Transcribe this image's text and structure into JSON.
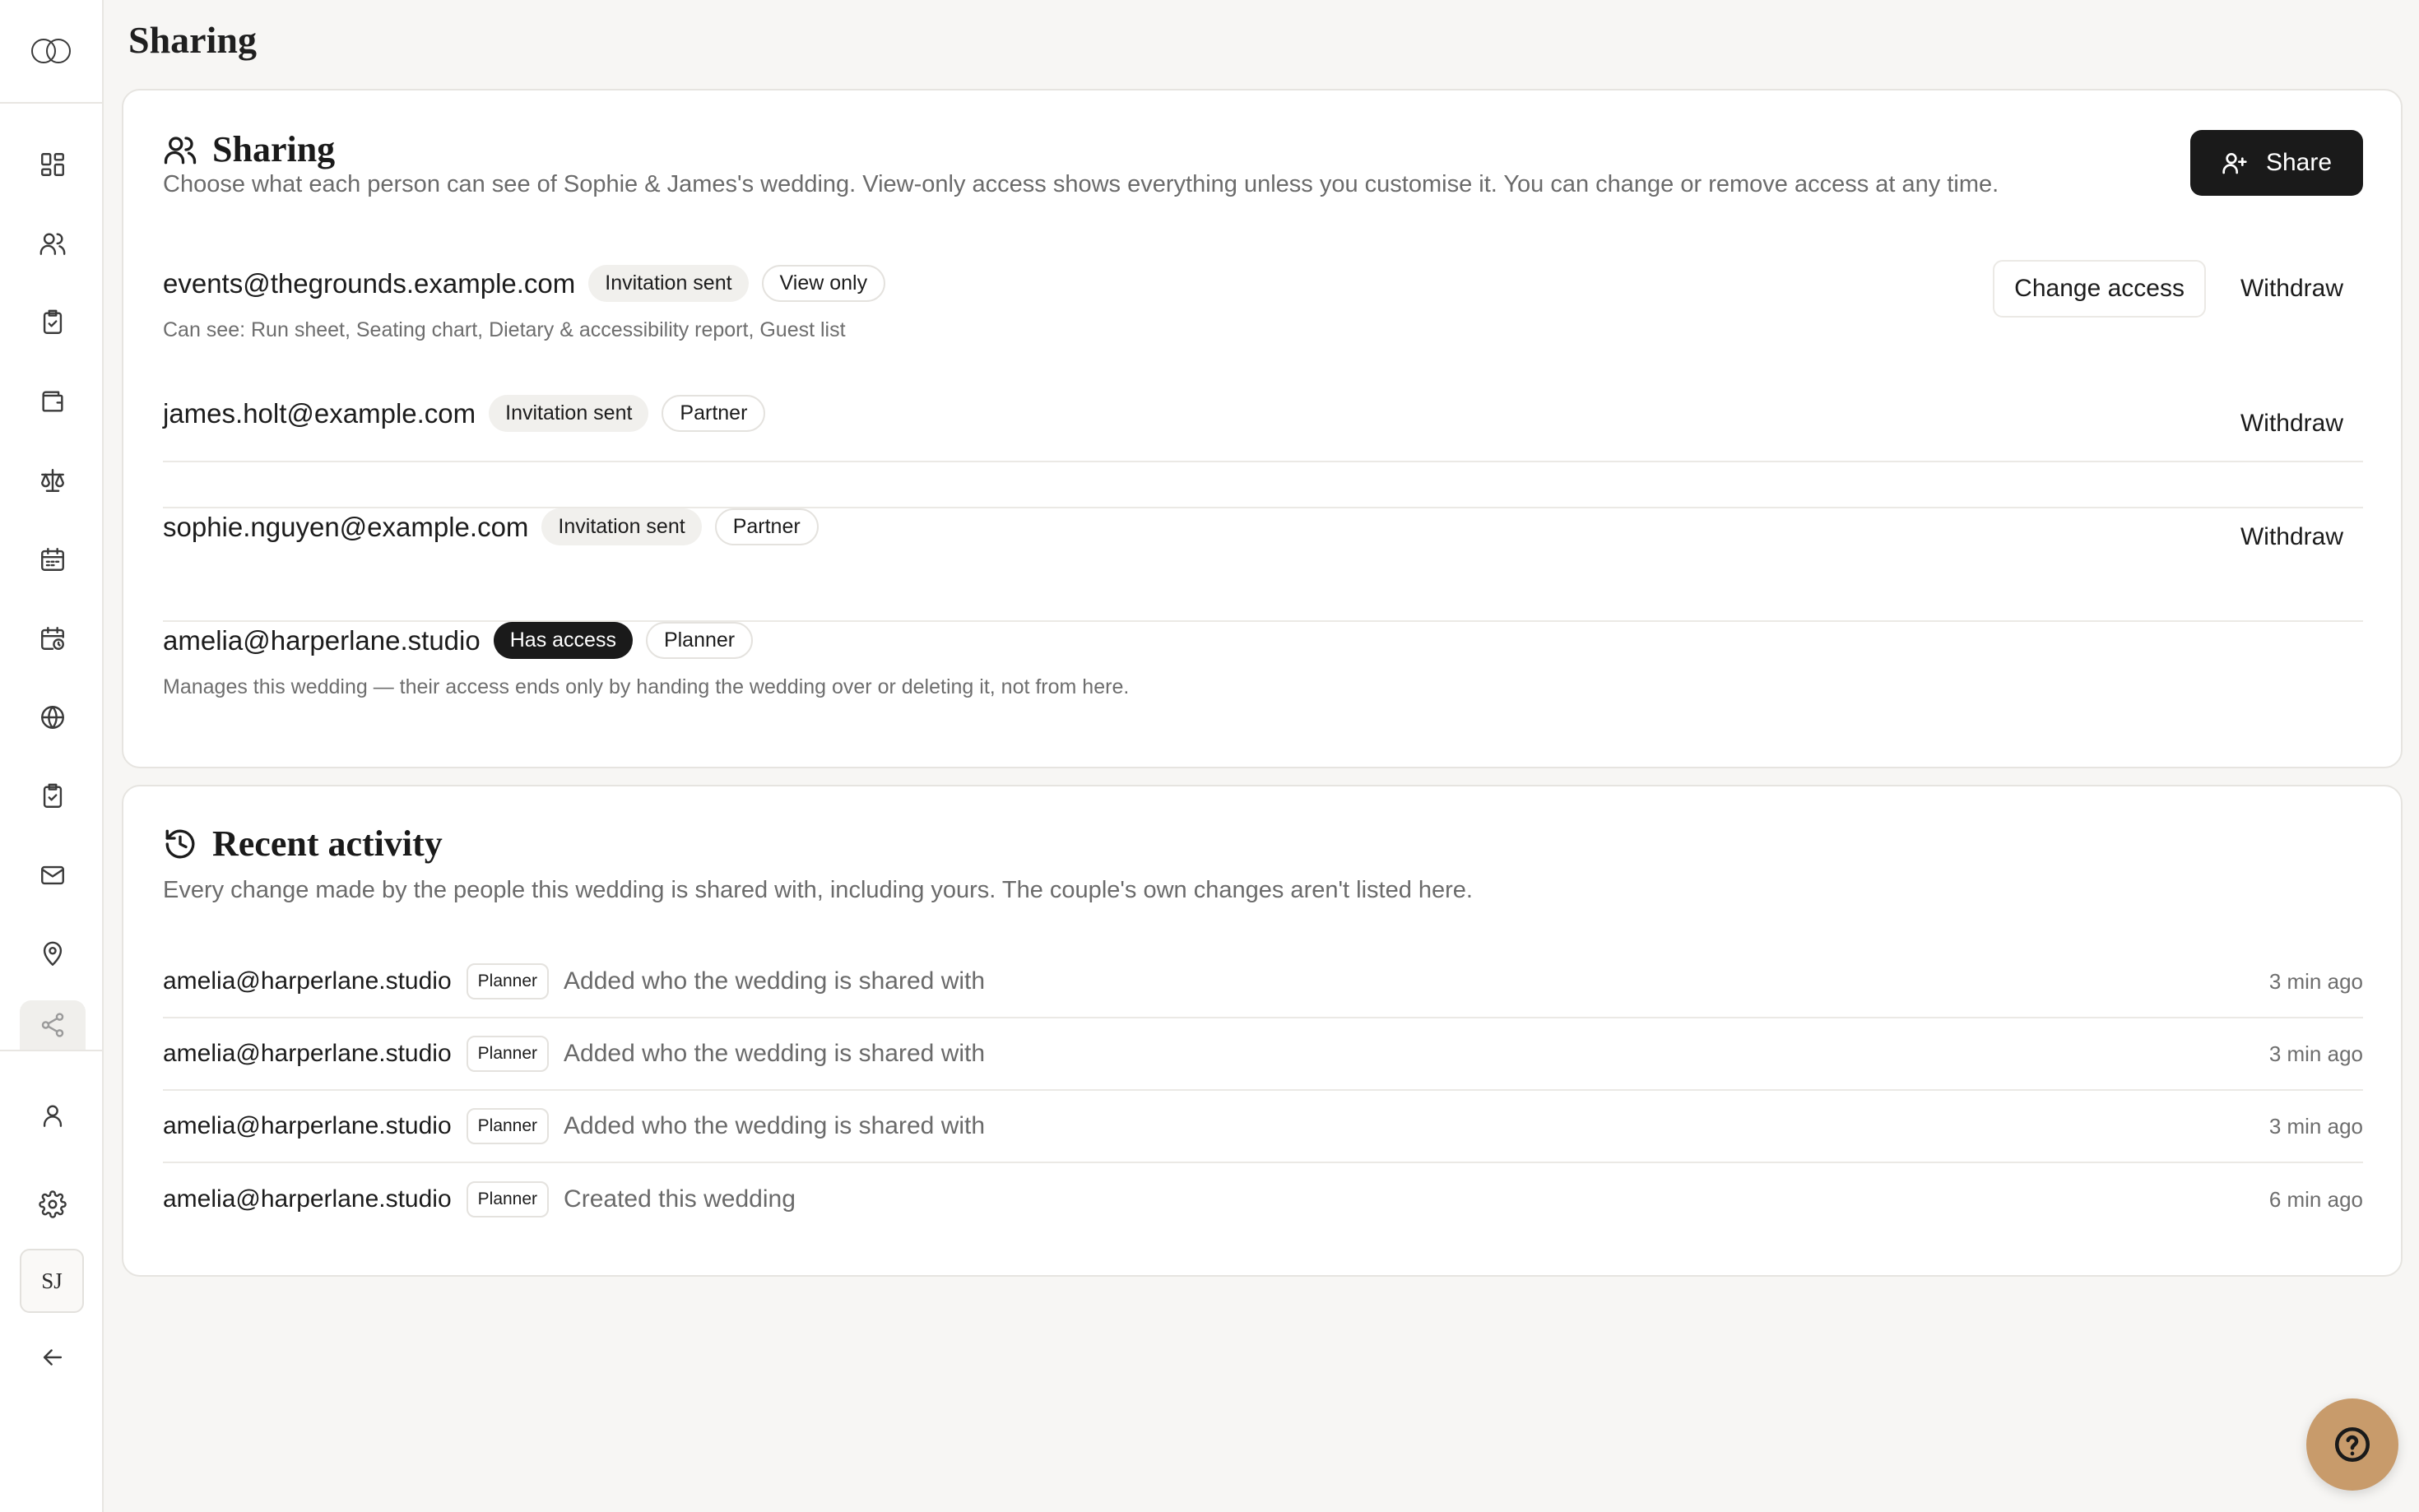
{
  "page": {
    "title": "Sharing"
  },
  "sidebar": {
    "items": [
      {
        "name": "dashboard-icon"
      },
      {
        "name": "guests-icon"
      },
      {
        "name": "checklist-icon"
      },
      {
        "name": "budget-icon"
      },
      {
        "name": "scales-icon"
      },
      {
        "name": "calendar-icon"
      },
      {
        "name": "schedule-icon"
      },
      {
        "name": "globe-icon"
      },
      {
        "name": "tasks-icon"
      },
      {
        "name": "mail-icon"
      },
      {
        "name": "location-icon"
      },
      {
        "name": "share-icon",
        "active": true
      }
    ],
    "bottom": [
      {
        "name": "user-icon"
      },
      {
        "name": "gear-icon"
      }
    ],
    "avatar_initials": "SJ",
    "back_icon": "arrow-left-icon"
  },
  "sharing": {
    "title": "Sharing",
    "description": "Choose what each person can see of Sophie & James's wedding. View-only access shows everything unless you customise it. You can change or remove access at any time.",
    "share_button": "Share",
    "people": [
      {
        "email": "events@thegrounds.example.com",
        "status": "Invitation sent",
        "role": "View only",
        "detail": "Can see: Run sheet, Seating chart, Dietary & accessibility report, Guest list",
        "change_label": "Change access",
        "withdraw_label": "Withdraw"
      },
      {
        "email": "james.holt@example.com",
        "status": "Invitation sent",
        "role": "Partner",
        "withdraw_label": "Withdraw"
      },
      {
        "email": "sophie.nguyen@example.com",
        "status": "Invitation sent",
        "role": "Partner",
        "withdraw_label": "Withdraw"
      },
      {
        "email": "amelia@harperlane.studio",
        "status": "Has access",
        "role": "Planner",
        "detail": "Manages this wedding — their access ends only by handing the wedding over or deleting it, not from here."
      }
    ]
  },
  "activity": {
    "title": "Recent activity",
    "description": "Every change made by the people this wedding is shared with, including yours. The couple's own changes aren't listed here.",
    "items": [
      {
        "who": "amelia@harperlane.studio",
        "role": "Planner",
        "what": "Added who the wedding is shared with",
        "when": "3 min ago"
      },
      {
        "who": "amelia@harperlane.studio",
        "role": "Planner",
        "what": "Added who the wedding is shared with",
        "when": "3 min ago"
      },
      {
        "who": "amelia@harperlane.studio",
        "role": "Planner",
        "what": "Added who the wedding is shared with",
        "when": "3 min ago"
      },
      {
        "who": "amelia@harperlane.studio",
        "role": "Planner",
        "what": "Created this wedding",
        "when": "6 min ago"
      }
    ]
  },
  "colors": {
    "accent_dark": "#1a1a1a",
    "help_button": "#c89b6b",
    "background": "#f7f6f4"
  }
}
